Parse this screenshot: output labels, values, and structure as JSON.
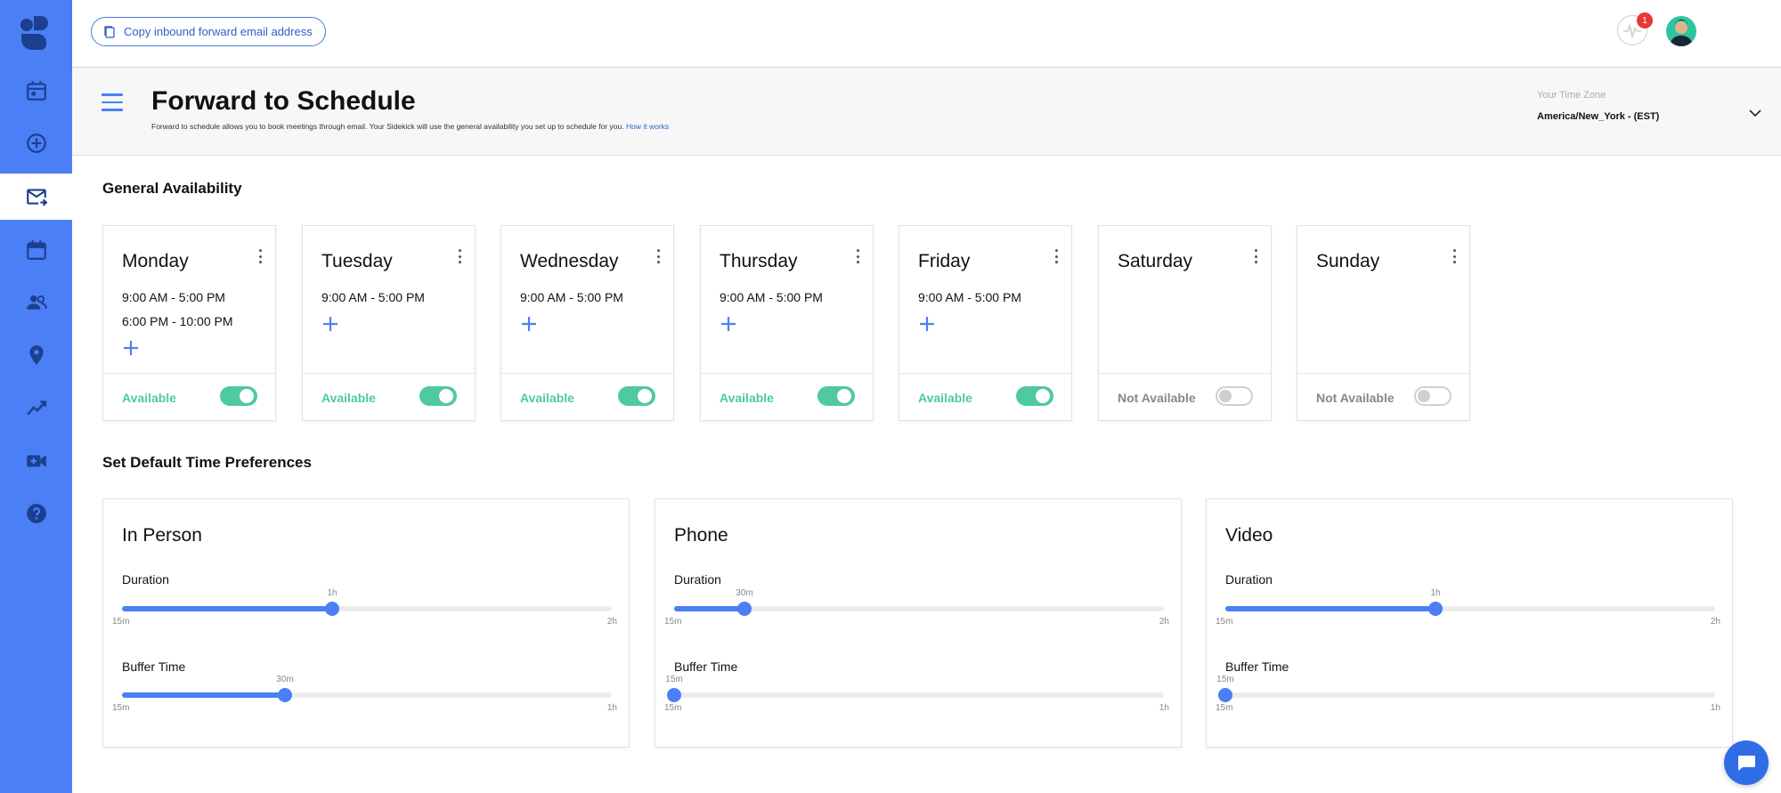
{
  "colors": {
    "accent": "#4a7ff5",
    "available": "#4fc9a2",
    "unavailable": "#888888",
    "link": "#2e5fc4"
  },
  "sidebar": {
    "items": [
      {
        "name": "calendar-icon",
        "active": false
      },
      {
        "name": "add-circle-icon",
        "active": false
      },
      {
        "name": "mail-forward-icon",
        "active": true
      },
      {
        "name": "calendar-blank-icon",
        "active": false
      },
      {
        "name": "people-icon",
        "active": false
      },
      {
        "name": "location-pin-icon",
        "active": false
      },
      {
        "name": "analytics-icon",
        "active": false
      },
      {
        "name": "video-camera-icon",
        "active": false
      },
      {
        "name": "help-icon",
        "active": false
      }
    ]
  },
  "topbar": {
    "copy_label": "Copy inbound forward email address",
    "notification_count": "1"
  },
  "header": {
    "title": "Forward to Schedule",
    "description": "Forward to schedule allows you to book meetings through email. Your Sidekick will use the general availability you set up to schedule for you.",
    "how_link": "How it works",
    "tz_label": "Your Time Zone",
    "tz_value": "America/New_York - (EST)"
  },
  "availability": {
    "title": "General Availability",
    "days": [
      {
        "name": "Monday",
        "slots": [
          "9:00 AM - 5:00 PM",
          "6:00 PM - 10:00 PM"
        ],
        "status": "Available",
        "on": true
      },
      {
        "name": "Tuesday",
        "slots": [
          "9:00 AM - 5:00 PM"
        ],
        "status": "Available",
        "on": true
      },
      {
        "name": "Wednesday",
        "slots": [
          "9:00 AM - 5:00 PM"
        ],
        "status": "Available",
        "on": true
      },
      {
        "name": "Thursday",
        "slots": [
          "9:00 AM - 5:00 PM"
        ],
        "status": "Available",
        "on": true
      },
      {
        "name": "Friday",
        "slots": [
          "9:00 AM - 5:00 PM"
        ],
        "status": "Available",
        "on": true
      },
      {
        "name": "Saturday",
        "slots": [],
        "status": "Not Available",
        "on": false
      },
      {
        "name": "Sunday",
        "slots": [],
        "status": "Not Available",
        "on": false
      }
    ]
  },
  "preferences": {
    "title": "Set Default Time Preferences",
    "duration_label": "Duration",
    "buffer_label": "Buffer Time",
    "cards": [
      {
        "title": "In Person",
        "duration": {
          "value": "1h",
          "min": "15m",
          "max": "2h",
          "fraction": 0.4286
        },
        "buffer": {
          "value": "30m",
          "min": "15m",
          "max": "1h",
          "fraction": 0.3333
        }
      },
      {
        "title": "Phone",
        "duration": {
          "value": "30m",
          "min": "15m",
          "max": "2h",
          "fraction": 0.1429
        },
        "buffer": {
          "value": "15m",
          "min": "15m",
          "max": "1h",
          "fraction": 0
        }
      },
      {
        "title": "Video",
        "duration": {
          "value": "1h",
          "min": "15m",
          "max": "2h",
          "fraction": 0.4286
        },
        "buffer": {
          "value": "15m",
          "min": "15m",
          "max": "1h",
          "fraction": 0
        }
      }
    ]
  }
}
